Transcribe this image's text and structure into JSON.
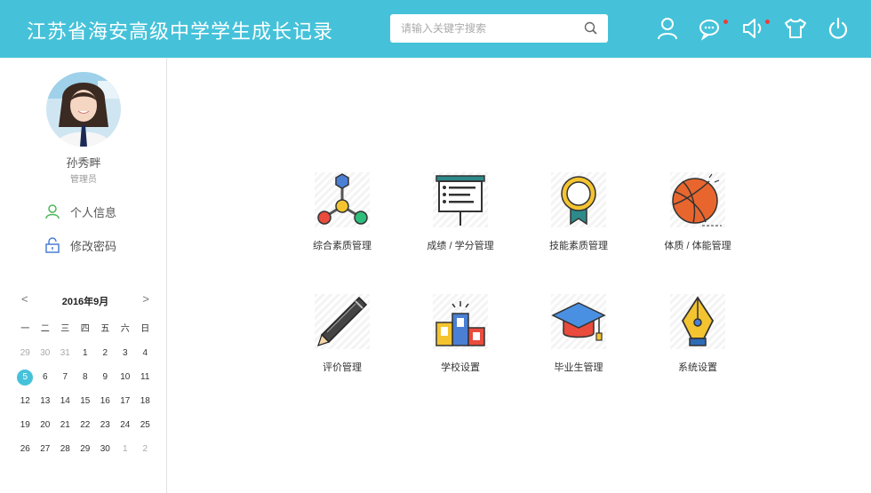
{
  "header": {
    "title": "江苏省海安高级中学学生成长记录",
    "search_placeholder": "请输入关键字搜索",
    "icons": [
      "user-icon",
      "message-icon",
      "notification-icon",
      "shirt-icon",
      "power-icon"
    ]
  },
  "user": {
    "name": "孙秀畔",
    "role": "管理员"
  },
  "sidebar": {
    "links": [
      {
        "label": "个人信息",
        "icon": "person-icon"
      },
      {
        "label": "修改密码",
        "icon": "lock-icon"
      }
    ]
  },
  "calendar": {
    "title": "2016年9月",
    "prev": "<",
    "next": ">",
    "weekdays": [
      "一",
      "二",
      "三",
      "四",
      "五",
      "六",
      "日"
    ],
    "days": [
      [
        "29",
        "30",
        "31",
        "1",
        "2",
        "3",
        "4"
      ],
      [
        "5",
        "6",
        "7",
        "8",
        "9",
        "10",
        "11"
      ],
      [
        "12",
        "13",
        "14",
        "15",
        "16",
        "17",
        "18"
      ],
      [
        "19",
        "20",
        "21",
        "22",
        "23",
        "24",
        "25"
      ],
      [
        "26",
        "27",
        "28",
        "29",
        "30",
        "1",
        "2"
      ]
    ],
    "today": "5"
  },
  "modules": [
    {
      "label": "综合素质管理",
      "icon": "molecule-icon"
    },
    {
      "label": "成绩 / 学分管理",
      "icon": "board-icon"
    },
    {
      "label": "技能素质管理",
      "icon": "medal-icon"
    },
    {
      "label": "体质 / 体能管理",
      "icon": "basketball-icon"
    },
    {
      "label": "评价管理",
      "icon": "pen-icon"
    },
    {
      "label": "学校设置",
      "icon": "podium-icon"
    },
    {
      "label": "毕业生管理",
      "icon": "graduation-cap-icon"
    },
    {
      "label": "系统设置",
      "icon": "fountain-pen-icon"
    }
  ],
  "colors": {
    "accent": "#45c2d9",
    "badge": "#f23b3b"
  }
}
